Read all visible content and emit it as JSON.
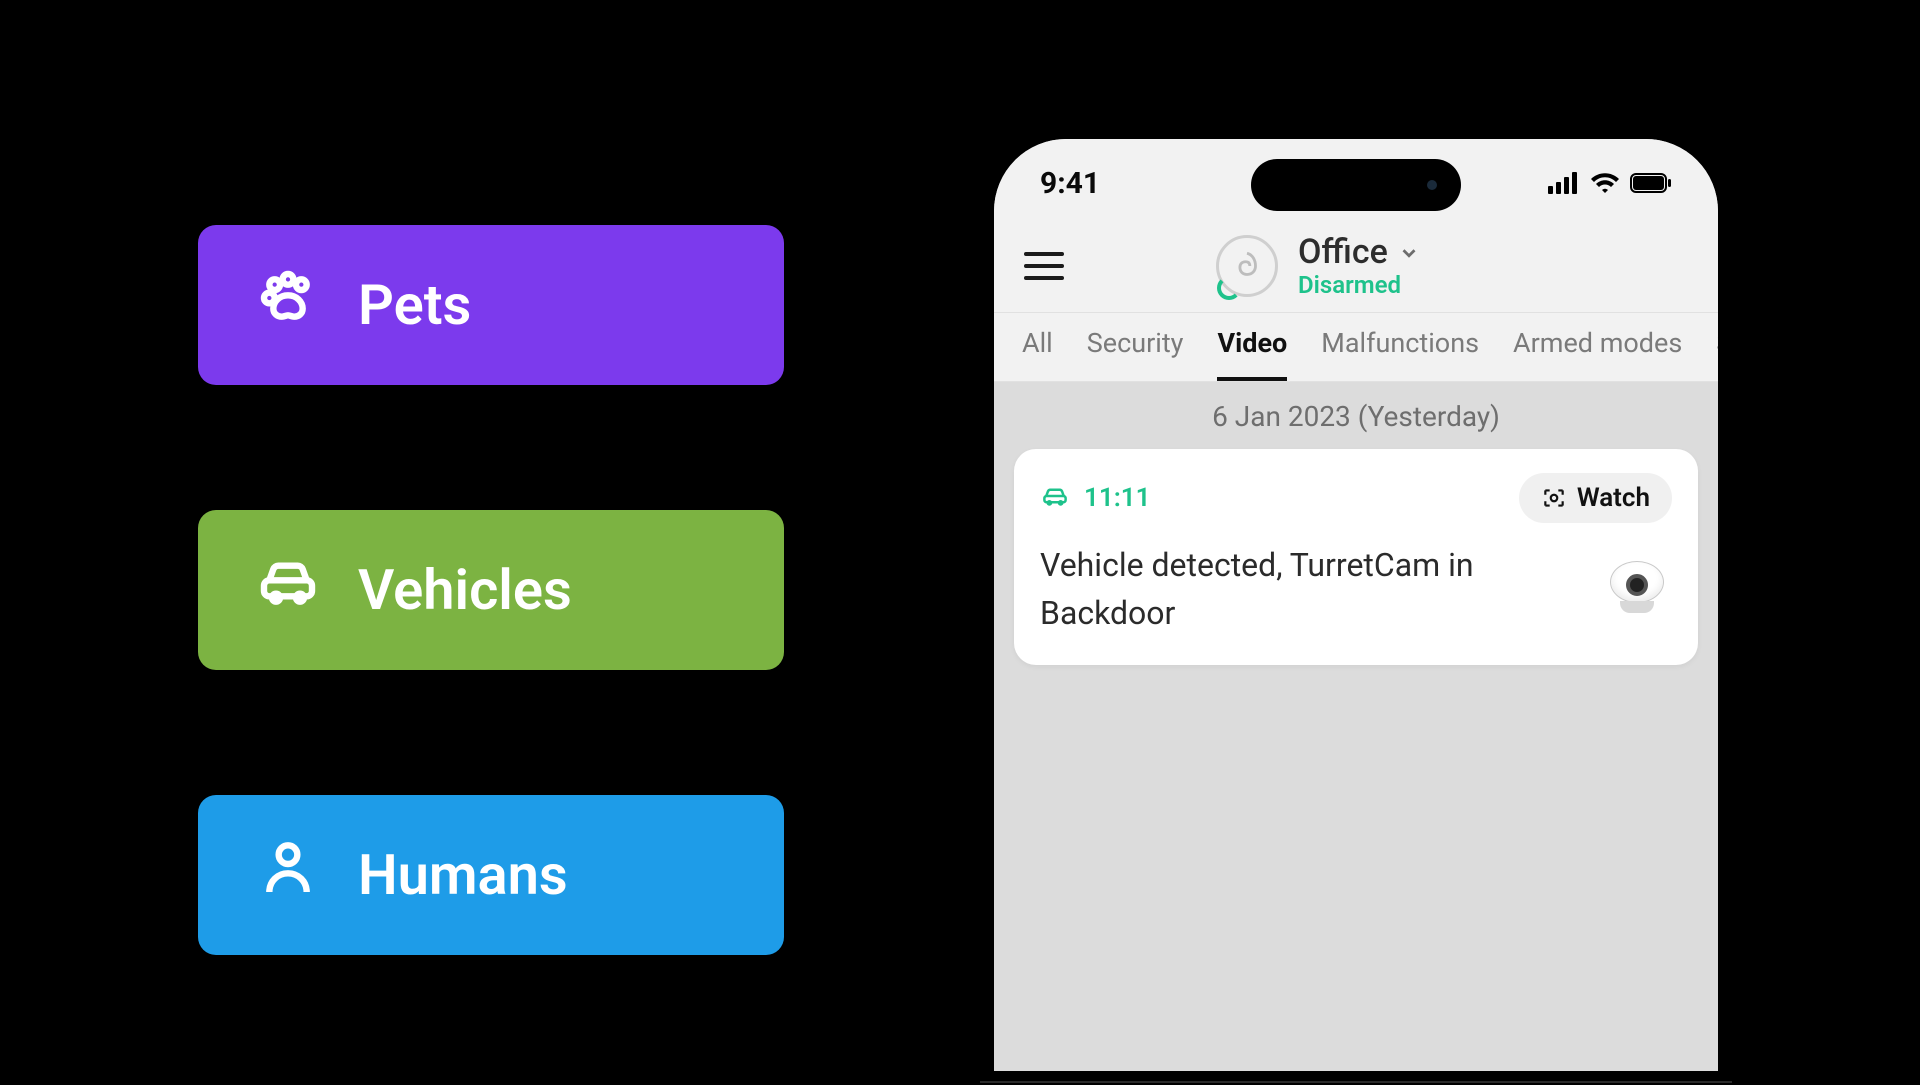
{
  "categories": {
    "pets": {
      "label": "Pets",
      "color": "#7C3AED"
    },
    "vehicles": {
      "label": "Vehicles",
      "color": "#7CB342"
    },
    "humans": {
      "label": "Humans",
      "color": "#1E9CE8"
    }
  },
  "phone": {
    "statusbar": {
      "time": "9:41"
    },
    "header": {
      "hub_name": "Office",
      "hub_status": "Disarmed"
    },
    "tabs": {
      "items": [
        "All",
        "Security",
        "Video",
        "Malfunctions",
        "Armed modes",
        "Sm"
      ],
      "active_index": 2
    },
    "feed": {
      "date_label": "6 Jan 2023 (Yesterday)",
      "event": {
        "time": "11:11",
        "watch_label": "Watch",
        "message": "Vehicle detected, TurretCam in Backdoor"
      }
    }
  }
}
